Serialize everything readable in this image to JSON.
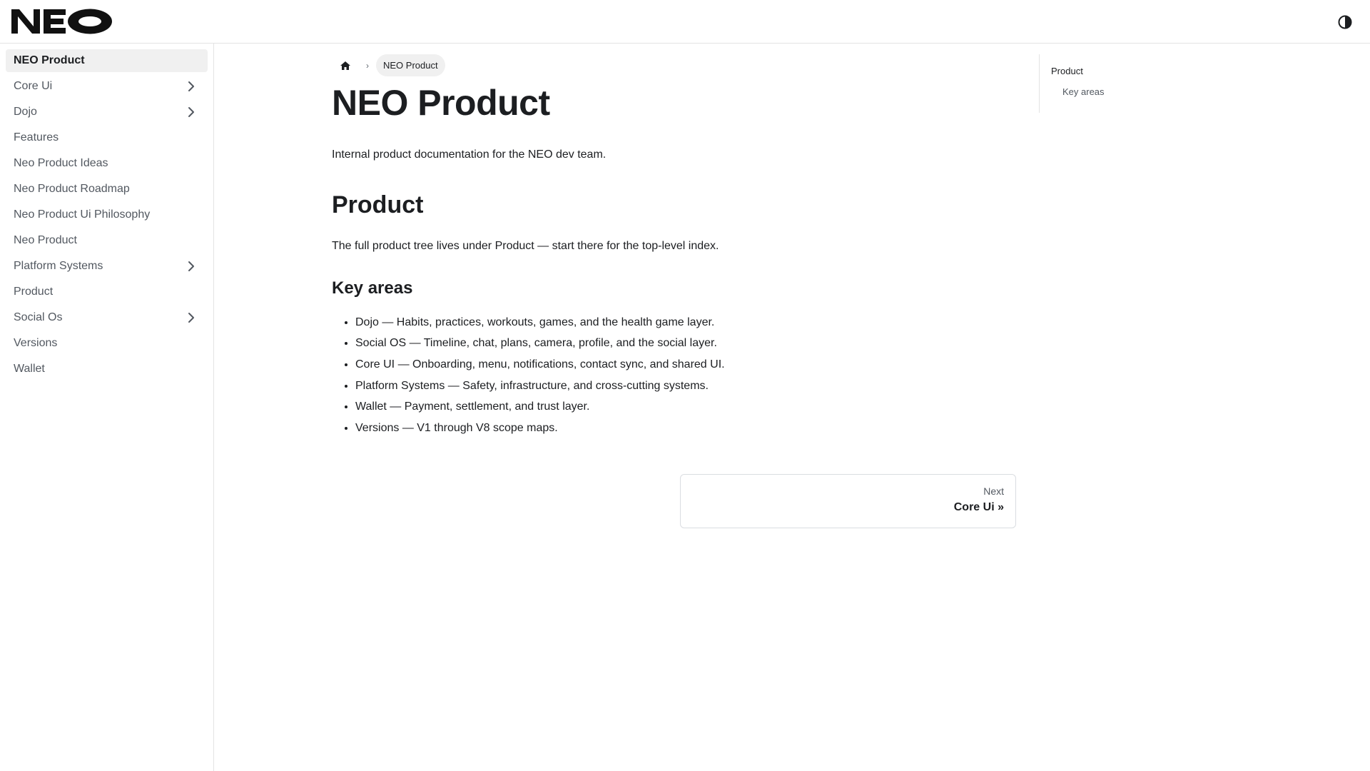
{
  "navbar": {
    "logo_text": "NEO",
    "theme_toggle_icon": "contrast-icon"
  },
  "sidebar": {
    "items": [
      {
        "label": "NEO Product",
        "active": true,
        "expandable": false
      },
      {
        "label": "Core Ui",
        "active": false,
        "expandable": true
      },
      {
        "label": "Dojo",
        "active": false,
        "expandable": true
      },
      {
        "label": "Features",
        "active": false,
        "expandable": false
      },
      {
        "label": "Neo Product Ideas",
        "active": false,
        "expandable": false
      },
      {
        "label": "Neo Product Roadmap",
        "active": false,
        "expandable": false
      },
      {
        "label": "Neo Product Ui Philosophy",
        "active": false,
        "expandable": false
      },
      {
        "label": "Neo Product",
        "active": false,
        "expandable": false
      },
      {
        "label": "Platform Systems",
        "active": false,
        "expandable": true
      },
      {
        "label": "Product",
        "active": false,
        "expandable": false
      },
      {
        "label": "Social Os",
        "active": false,
        "expandable": true
      },
      {
        "label": "Versions",
        "active": false,
        "expandable": false
      },
      {
        "label": "Wallet",
        "active": false,
        "expandable": false
      }
    ]
  },
  "breadcrumb": {
    "home_icon": "home-icon",
    "separator": "›",
    "current": "NEO Product"
  },
  "main": {
    "title": "NEO Product",
    "intro": "Internal product documentation for the NEO dev team.",
    "product_heading": "Product",
    "product_text": "The full product tree lives under Product — start there for the top-level index.",
    "key_areas_heading": "Key areas",
    "key_areas": [
      "Dojo — Habits, practices, workouts, games, and the health game layer.",
      "Social OS — Timeline, chat, plans, camera, profile, and the social layer.",
      "Core UI — Onboarding, menu, notifications, contact sync, and shared UI.",
      "Platform Systems — Safety, infrastructure, and cross-cutting systems.",
      "Wallet — Payment, settlement, and trust layer.",
      "Versions — V1 through V8 scope maps."
    ]
  },
  "pager": {
    "sub_label": "Next",
    "label": "Core Ui »"
  },
  "toc": {
    "items": [
      {
        "label": "Product",
        "level": 2
      },
      {
        "label": "Key areas",
        "level": 3
      }
    ]
  },
  "colors": {
    "text": "#1c1e21",
    "muted": "#525860",
    "active_bg": "#f0f0f0",
    "border": "#e3e3e3"
  }
}
